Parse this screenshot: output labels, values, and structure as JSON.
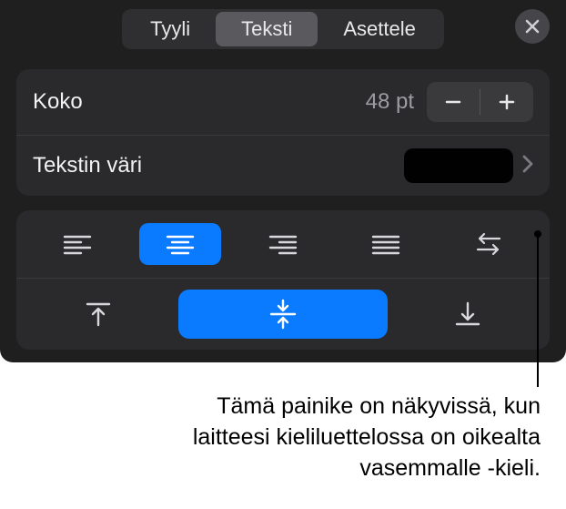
{
  "tabs": {
    "style": "Tyyli",
    "text": "Teksti",
    "arrange": "Asettele"
  },
  "size": {
    "label": "Koko",
    "value": "48 pt"
  },
  "textColor": {
    "label": "Tekstin väri",
    "swatch": "#010101"
  },
  "caption": "Tämä painike on näkyvissä, kun laitteesi kieliluettelossa on oikealta vasemmalle -kieli."
}
